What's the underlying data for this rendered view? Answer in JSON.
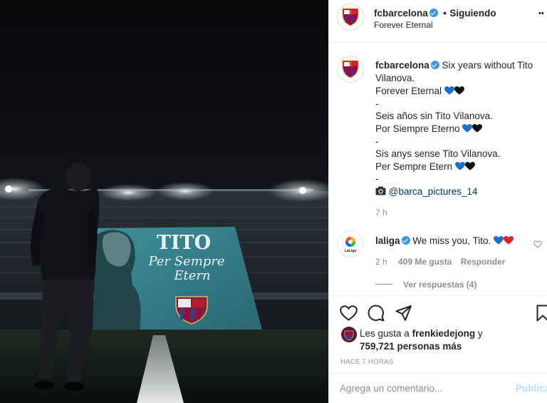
{
  "post": {
    "account": "fcbarcelona",
    "follow_state": "Siguiendo",
    "dot_sep": "•",
    "location": "Forever Eternal",
    "more_label": "••",
    "banner": {
      "title": "TITO",
      "line1": "Per Sempre",
      "line2": "Etern"
    }
  },
  "caption": {
    "account": "fcbarcelona",
    "first_line": "Six years without Tito",
    "lines": [
      "Vilanova.",
      "Forever Eternal",
      "-",
      "Seis años sin Tito Vilanova.",
      "Por Siempre Eterno",
      "-",
      "Sis anys sense Tito Vilanova.",
      "Per Sempre Etern",
      "-"
    ],
    "mention": "@barca_pictures_14",
    "time": "7 h"
  },
  "comment": {
    "account": "laliga",
    "logo_text": "LaLiga",
    "text": "We miss you, Tito.",
    "time": "2 h",
    "likes": "409 Me gusta",
    "reply": "Responder",
    "view_replies": "Ver respuestas (4)"
  },
  "likes": {
    "prefix": "Les gusta a",
    "user": "frenkiedejong",
    "suffix": "y",
    "others": "759,721 personas más"
  },
  "timestamp": "HACE 7 HORAS",
  "add_comment": {
    "placeholder": "Agrega un comentario...",
    "publish": "Publicar"
  },
  "colors": {
    "verified": "#3897f0",
    "link": "#00376b",
    "heart_blue": "#1f6fd1",
    "heart_red": "#e0202a",
    "publish_disabled": "#b2dffc",
    "barca_blue": "#1a4aa0",
    "barca_red": "#a50044"
  }
}
